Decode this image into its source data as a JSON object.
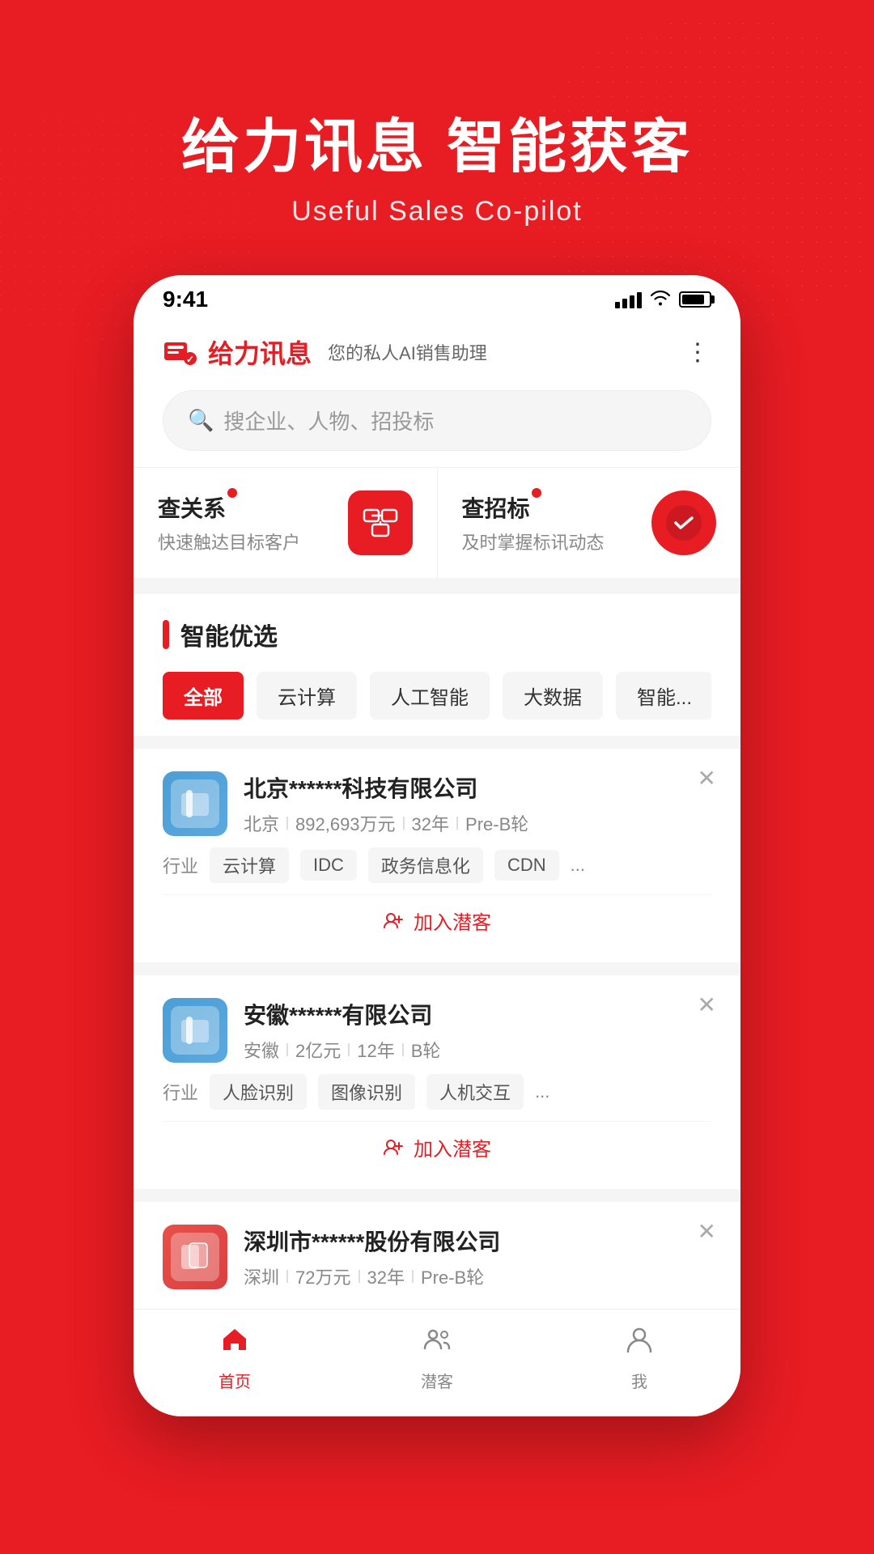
{
  "hero": {
    "title_part1": "给力讯息 智能",
    "title_highlight": "获客",
    "subtitle": "Useful Sales Co-pilot"
  },
  "status_bar": {
    "time": "9:41"
  },
  "app_header": {
    "name": "给力讯息",
    "tagline": "您的私人AI销售助理"
  },
  "search": {
    "placeholder": "搜企业、人物、招投标"
  },
  "quick_actions": [
    {
      "id": "relations",
      "title": "查关系",
      "subtitle": "快速触达目标客户"
    },
    {
      "id": "bidding",
      "title": "查招标",
      "subtitle": "及时掌握标讯动态"
    }
  ],
  "smart_section": {
    "title": "智能优选"
  },
  "categories": [
    {
      "label": "全部",
      "active": true
    },
    {
      "label": "云计算",
      "active": false
    },
    {
      "label": "人工智能",
      "active": false
    },
    {
      "label": "大数据",
      "active": false
    },
    {
      "label": "智能...",
      "active": false
    }
  ],
  "companies": [
    {
      "name": "北京******科技有限公司",
      "location": "北京",
      "funding": "892,693万元",
      "age": "32年",
      "round": "Pre-B轮",
      "industry_label": "行业",
      "tags": [
        "云计算",
        "IDC",
        "政务信息化",
        "CDN"
      ],
      "tag_more": "...",
      "add_label": "加入潜客",
      "logo_color": "blue"
    },
    {
      "name": "安徽******有限公司",
      "location": "安徽",
      "funding": "2亿元",
      "age": "12年",
      "round": "B轮",
      "industry_label": "行业",
      "tags": [
        "人脸识别",
        "图像识别",
        "人机交互"
      ],
      "tag_more": "...",
      "add_label": "加入潜客",
      "logo_color": "blue"
    },
    {
      "name": "深圳市******股份有限公司",
      "location": "深圳",
      "funding": "72万元",
      "age": "32年",
      "round": "Pre-B轮",
      "logo_color": "pink"
    }
  ],
  "bottom_nav": [
    {
      "label": "首页",
      "active": true,
      "icon": "home"
    },
    {
      "label": "潜客",
      "active": false,
      "icon": "people"
    },
    {
      "label": "我",
      "active": false,
      "icon": "person"
    }
  ]
}
